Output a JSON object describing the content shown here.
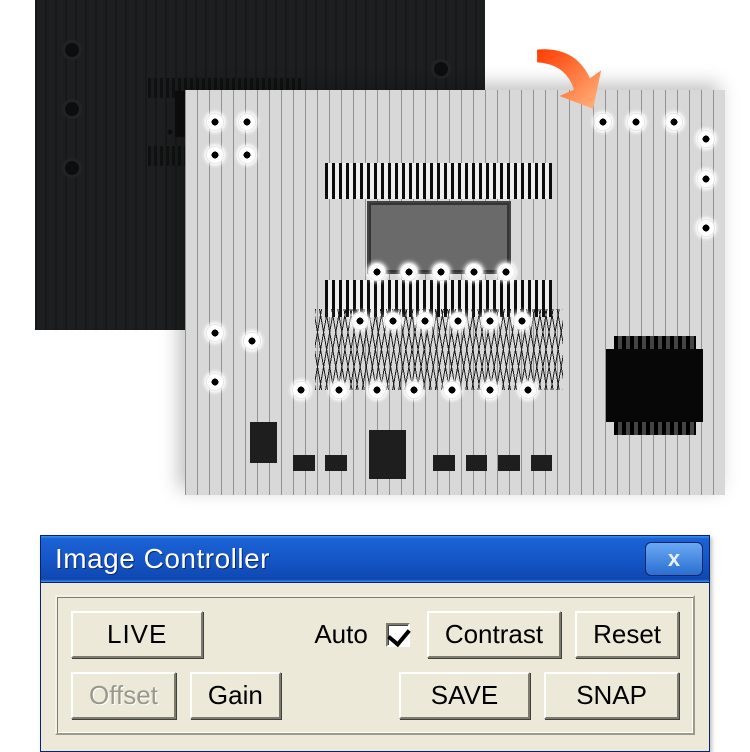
{
  "arrow": {
    "color_start": "#ff2a00",
    "color_end": "#ffb066"
  },
  "dialog": {
    "title": "Image Controller",
    "close_label": "x",
    "group": {
      "live": "LIVE",
      "auto_label": "Auto",
      "auto_checked": true,
      "contrast": "Contrast",
      "reset": "Reset",
      "offset": "Offset",
      "offset_disabled": true,
      "gain": "Gain",
      "save": "SAVE",
      "snap": "SNAP"
    }
  }
}
